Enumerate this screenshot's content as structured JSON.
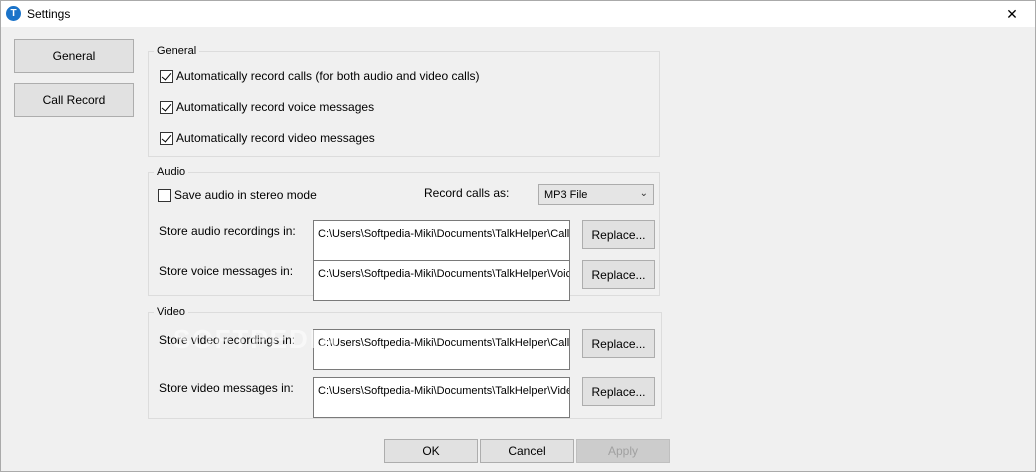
{
  "window": {
    "title": "Settings",
    "app_icon_letter": "T",
    "close_glyph": "✕"
  },
  "nav": {
    "general": "General",
    "call_record": "Call Record"
  },
  "general": {
    "label": "General",
    "options": [
      {
        "label": "Automatically record calls (for both audio and video calls)",
        "checked": true
      },
      {
        "label": "Automatically record voice messages",
        "checked": true
      },
      {
        "label": "Automatically record video messages",
        "checked": true
      }
    ]
  },
  "audio": {
    "label": "Audio",
    "stereo_label": "Save audio in stereo mode",
    "stereo_checked": false,
    "record_as_label": "Record calls as:",
    "record_as_value": "MP3 File",
    "store_audio_label": "Store audio recordings in:",
    "store_audio_path": "C:\\Users\\Softpedia-Miki\\Documents\\TalkHelper\\CallR",
    "store_voice_label": "Store voice messages in:",
    "store_voice_path": "C:\\Users\\Softpedia-Miki\\Documents\\TalkHelper\\Voice"
  },
  "video": {
    "label": "Video",
    "store_rec_label": "Store video recordings in:",
    "store_rec_path": "C:\\Users\\Softpedia-Miki\\Documents\\TalkHelper\\CallR",
    "store_msg_label": "Store video messages in:",
    "store_msg_path": "C:\\Users\\Softpedia-Miki\\Documents\\TalkHelper\\Video"
  },
  "replace_label": "Replace...",
  "buttons": {
    "ok": "OK",
    "cancel": "Cancel",
    "apply": "Apply"
  },
  "watermark": "SOFTPEDIA",
  "colors": {
    "app_icon": "#1a73c9",
    "window_bg": "#f0f0f0"
  }
}
